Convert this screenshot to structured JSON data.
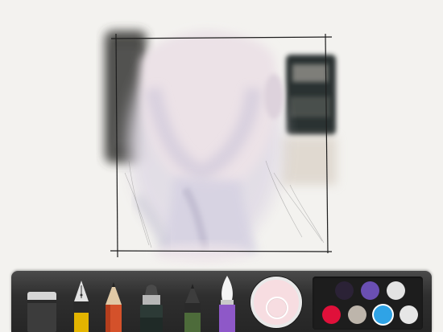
{
  "app": {
    "screen": "drawing-canvas"
  },
  "canvas": {
    "background_color": "#f3f2ef",
    "subject": "watercolor-face-sketch"
  },
  "toolbar": {
    "tools": [
      {
        "id": "eraser",
        "icon": "eraser-icon"
      },
      {
        "id": "fountain-pen",
        "icon": "fountain-pen-icon"
      },
      {
        "id": "pencil",
        "icon": "pencil-icon"
      },
      {
        "id": "marker",
        "icon": "marker-icon"
      },
      {
        "id": "outline-pen",
        "icon": "outline-pen-icon"
      },
      {
        "id": "watercolor-brush",
        "icon": "watercolor-brush-icon",
        "selected": true
      }
    ],
    "current_color": "#f7dde1",
    "palette": [
      {
        "color": "#2b2236",
        "selected": false
      },
      {
        "color": "#6a4fb3",
        "selected": false
      },
      {
        "color": "#e3e3e3",
        "selected": false
      },
      {
        "color": "#e0103a",
        "selected": false
      },
      {
        "color": "#bdb5ab",
        "selected": false
      },
      {
        "color": "#2fa3e6",
        "selected": true
      },
      {
        "color": "#e6e6e6",
        "selected": false
      }
    ]
  }
}
